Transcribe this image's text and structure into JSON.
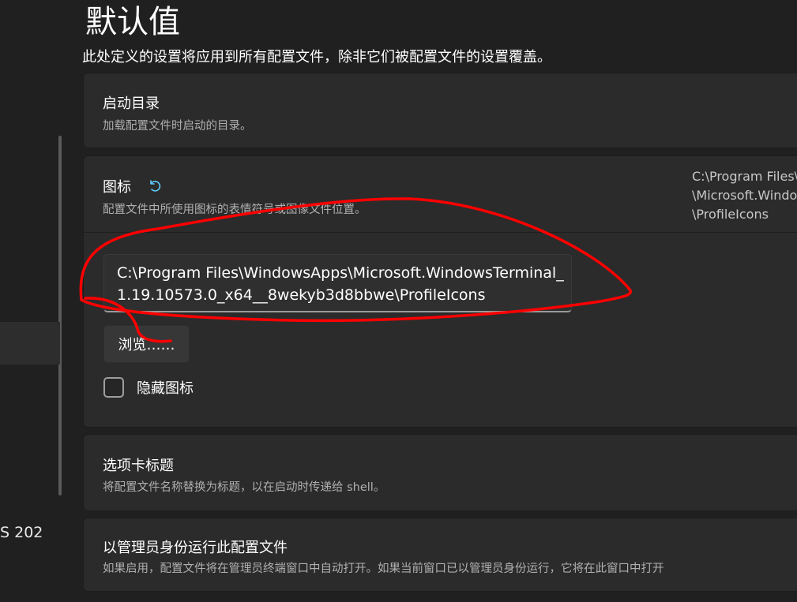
{
  "header": {
    "title": "默认值",
    "description": "此处定义的设置将应用到所有配置文件，除非它们被配置文件的设置覆盖。"
  },
  "nav": {
    "partial_item_text": "S 202"
  },
  "cards": {
    "startdir": {
      "title": "启动目录",
      "subtitle": "加载配置文件时启动的目录。"
    },
    "icon": {
      "title": "图标",
      "subtitle": "配置文件中所使用图标的表情符号或图像文件位置。",
      "summary_lines": [
        "C:\\Program Files\\",
        "\\Microsoft.Windo",
        "\\ProfileIcons"
      ],
      "path_value": "C:\\Program Files\\WindowsApps\\Microsoft.WindowsTerminal_\n1.19.10573.0_x64__8wekyb3d8bbwe\\ProfileIcons",
      "browse_label": "浏览……",
      "hide_icon_label": "隐藏图标",
      "hide_icon_checked": false
    },
    "tabtitle": {
      "title": "选项卡标题",
      "subtitle": "将配置文件名称替换为标题，以在启动时传递给 shell。"
    },
    "admin": {
      "title": "以管理员身份运行此配置文件",
      "subtitle": "如果启用，配置文件将在管理员终端窗口中自动打开。如果当前窗口已以管理员身份运行，它将在此窗口中打开"
    }
  },
  "colors": {
    "background": "#202020",
    "card": "#2b2b2b",
    "accent": "#60cdff",
    "annotation": "#ff0000"
  }
}
